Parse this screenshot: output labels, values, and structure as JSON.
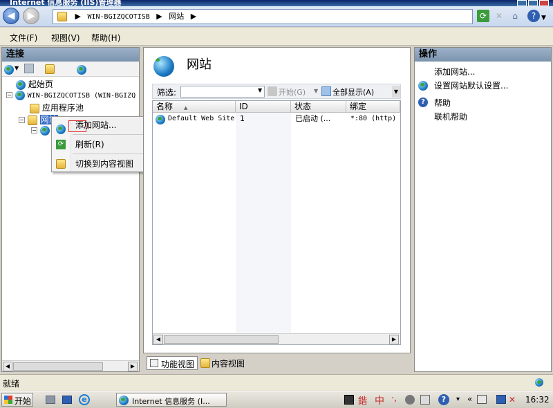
{
  "window": {
    "title": "Internet 信息服务 (IIS)管理器"
  },
  "address": {
    "segments": [
      "WIN-BGIZQCOTISB",
      "网站"
    ],
    "sep": "▶"
  },
  "menu": {
    "file": "文件(F)",
    "view": "视图(V)",
    "help": "帮助(H)"
  },
  "connections": {
    "header": "连接",
    "tree": {
      "start_page": "起始页",
      "server": "WIN-BGIZQCOTISB (WIN-BGIZQ",
      "app_pools": "应用程序池",
      "sites": "网站"
    }
  },
  "context_menu": {
    "add_site": "添加网站...",
    "refresh": "刷新(R)",
    "switch_content": "切换到内容视图"
  },
  "main": {
    "title": "网站",
    "filter_label": "筛选:",
    "start_label": "开始(G)",
    "show_all_label": "全部显示(A)",
    "columns": [
      "名称",
      "ID",
      "状态",
      "绑定"
    ],
    "sort_arrow": "▲",
    "rows": [
      {
        "name": "Default Web Site",
        "id": "1",
        "status": "已启动 (...",
        "binding": "*:80 (http)"
      }
    ],
    "view_tabs": {
      "features": "功能视图",
      "content": "内容视图"
    }
  },
  "actions": {
    "header": "操作",
    "add_site": "添加网站...",
    "set_defaults": "设置网站默认设置...",
    "help": "帮助",
    "online_help": "联机帮助"
  },
  "status": {
    "text": "就绪"
  },
  "taskbar": {
    "start": "开始",
    "task": "Internet 信息服务 (I...",
    "ime": "中",
    "time": "16:32"
  },
  "colors": {
    "accent": "#0a246a",
    "selection": "#316ac5",
    "highlight_border": "#e03030"
  }
}
